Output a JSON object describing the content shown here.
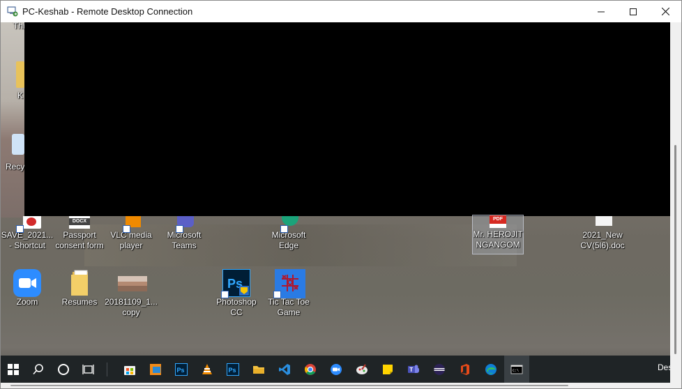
{
  "window": {
    "title": "PC-Keshab - Remote Desktop Connection",
    "controls": [
      "minimize",
      "maximize",
      "close"
    ]
  },
  "desktop": {
    "partial_labels": [
      "Thi",
      "K",
      "Recy"
    ],
    "row1": [
      {
        "label": "SAVE_2021...\n- Shortcut",
        "icon": "pdf-shortcut-icon"
      },
      {
        "label": "Passport\nconsent form",
        "icon": "docx-file-icon",
        "badge": "DOCX"
      },
      {
        "label": "VLC media\nplayer",
        "icon": "vlc-icon"
      },
      {
        "label": "Microsoft\nTeams",
        "icon": "teams-icon"
      },
      {
        "label": "Microsoft\nEdge",
        "icon": "edge-icon"
      },
      {
        "label": "Mr. HEROJIT\nNGANGOM",
        "icon": "pdf-file-icon",
        "badge": "PDF"
      },
      {
        "label": "2021_New\nCV(5l6).doc",
        "icon": "doc-file-icon"
      }
    ],
    "row2": [
      {
        "label": "Zoom",
        "icon": "zoom-icon"
      },
      {
        "label": "Resumes",
        "icon": "folder-icon"
      },
      {
        "label": "20181109_1...\ncopy",
        "icon": "image-thumbnail-icon"
      },
      {
        "label": "Photoshop\nCC",
        "icon": "photoshop-icon",
        "badge": "Ps"
      },
      {
        "label": "Tic Tac Toe\nGame",
        "icon": "tictactoe-icon"
      }
    ]
  },
  "taskbar": {
    "items": [
      "windows-start-icon",
      "search-icon",
      "cortana-icon",
      "task-view-icon",
      "store-icon",
      "file-explorer-alt-icon",
      "photoshop-icon",
      "vlc-icon",
      "photoshop-icon-2",
      "folder-icon",
      "vscode-icon",
      "chrome-icon",
      "zoom-icon",
      "paint-icon",
      "sticky-notes-icon",
      "teams-icon",
      "eclipse-icon",
      "office-icon",
      "edge-icon",
      "cmd-icon"
    ],
    "overflow_text": "Des"
  },
  "colors": {
    "taskbar": "#1f2426",
    "zoom": "#2d8cff",
    "photoshop": "#001e36",
    "photoshop_text": "#31a8ff",
    "pdf": "#e02b20",
    "black_region": "#000000"
  }
}
